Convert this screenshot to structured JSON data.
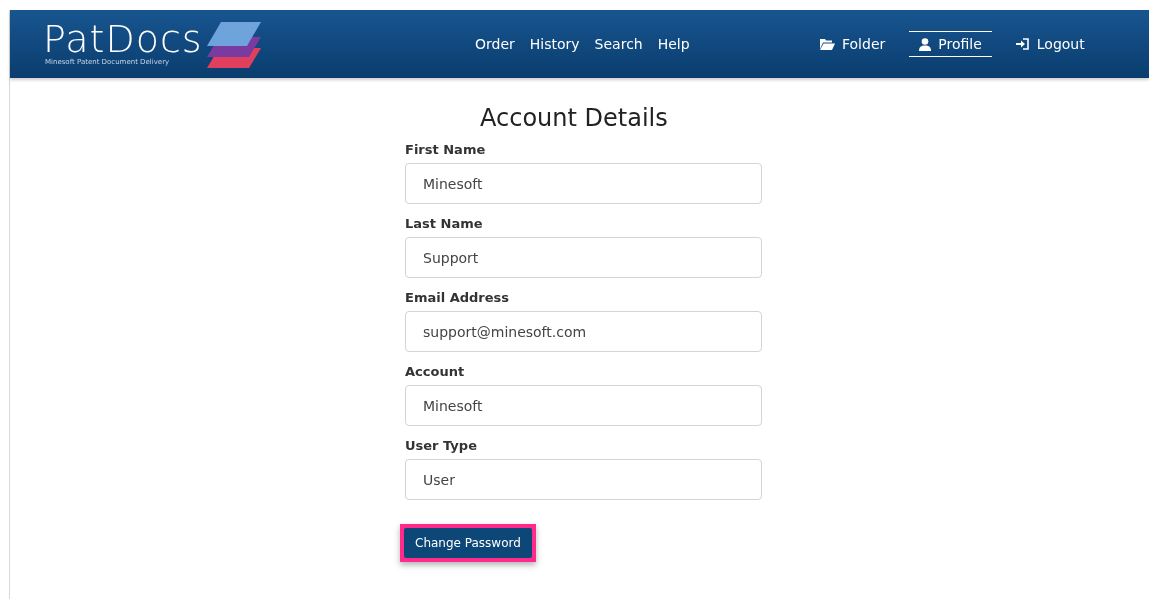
{
  "header": {
    "logo": {
      "name": "PatDocs",
      "tagline": "Minesoft Patent Document Delivery"
    },
    "nav": [
      {
        "label": "Order",
        "selected": false
      },
      {
        "label": "History",
        "selected": false
      },
      {
        "label": "Search",
        "selected": false
      },
      {
        "label": "Help",
        "selected": false
      }
    ],
    "user_nav": [
      {
        "label": "Folder",
        "kind": "folder",
        "selected": false
      },
      {
        "label": "Profile",
        "kind": "profile",
        "selected": true
      },
      {
        "label": "Logout",
        "kind": "logout",
        "selected": false
      }
    ]
  },
  "page": {
    "title": "Account Details",
    "fields": [
      {
        "label": "First Name",
        "value": "Minesoft"
      },
      {
        "label": "Last Name",
        "value": "Support"
      },
      {
        "label": "Email Address",
        "value": "support@minesoft.com"
      },
      {
        "label": "Account",
        "value": "Minesoft"
      },
      {
        "label": "User Type",
        "value": "User"
      }
    ],
    "button": {
      "label": "Change Password",
      "highlighted": true
    }
  }
}
